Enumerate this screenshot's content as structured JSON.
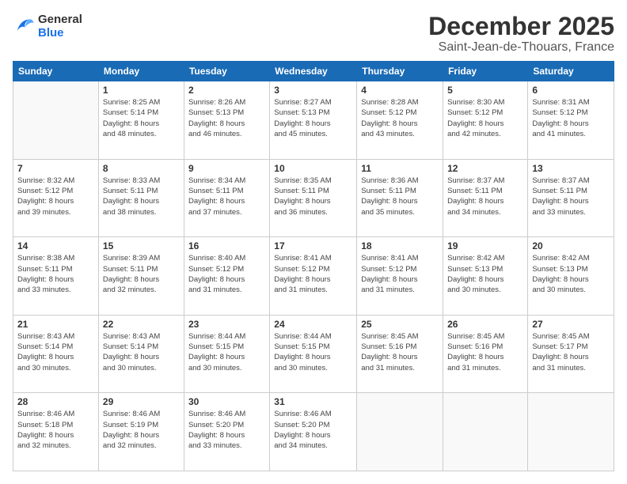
{
  "logo": {
    "line1": "General",
    "line2": "Blue"
  },
  "title": "December 2025",
  "subtitle": "Saint-Jean-de-Thouars, France",
  "weekdays": [
    "Sunday",
    "Monday",
    "Tuesday",
    "Wednesday",
    "Thursday",
    "Friday",
    "Saturday"
  ],
  "weeks": [
    [
      {
        "day": "",
        "info": ""
      },
      {
        "day": "1",
        "info": "Sunrise: 8:25 AM\nSunset: 5:14 PM\nDaylight: 8 hours\nand 48 minutes."
      },
      {
        "day": "2",
        "info": "Sunrise: 8:26 AM\nSunset: 5:13 PM\nDaylight: 8 hours\nand 46 minutes."
      },
      {
        "day": "3",
        "info": "Sunrise: 8:27 AM\nSunset: 5:13 PM\nDaylight: 8 hours\nand 45 minutes."
      },
      {
        "day": "4",
        "info": "Sunrise: 8:28 AM\nSunset: 5:12 PM\nDaylight: 8 hours\nand 43 minutes."
      },
      {
        "day": "5",
        "info": "Sunrise: 8:30 AM\nSunset: 5:12 PM\nDaylight: 8 hours\nand 42 minutes."
      },
      {
        "day": "6",
        "info": "Sunrise: 8:31 AM\nSunset: 5:12 PM\nDaylight: 8 hours\nand 41 minutes."
      }
    ],
    [
      {
        "day": "7",
        "info": "Sunrise: 8:32 AM\nSunset: 5:12 PM\nDaylight: 8 hours\nand 39 minutes."
      },
      {
        "day": "8",
        "info": "Sunrise: 8:33 AM\nSunset: 5:11 PM\nDaylight: 8 hours\nand 38 minutes."
      },
      {
        "day": "9",
        "info": "Sunrise: 8:34 AM\nSunset: 5:11 PM\nDaylight: 8 hours\nand 37 minutes."
      },
      {
        "day": "10",
        "info": "Sunrise: 8:35 AM\nSunset: 5:11 PM\nDaylight: 8 hours\nand 36 minutes."
      },
      {
        "day": "11",
        "info": "Sunrise: 8:36 AM\nSunset: 5:11 PM\nDaylight: 8 hours\nand 35 minutes."
      },
      {
        "day": "12",
        "info": "Sunrise: 8:37 AM\nSunset: 5:11 PM\nDaylight: 8 hours\nand 34 minutes."
      },
      {
        "day": "13",
        "info": "Sunrise: 8:37 AM\nSunset: 5:11 PM\nDaylight: 8 hours\nand 33 minutes."
      }
    ],
    [
      {
        "day": "14",
        "info": "Sunrise: 8:38 AM\nSunset: 5:11 PM\nDaylight: 8 hours\nand 33 minutes."
      },
      {
        "day": "15",
        "info": "Sunrise: 8:39 AM\nSunset: 5:11 PM\nDaylight: 8 hours\nand 32 minutes."
      },
      {
        "day": "16",
        "info": "Sunrise: 8:40 AM\nSunset: 5:12 PM\nDaylight: 8 hours\nand 31 minutes."
      },
      {
        "day": "17",
        "info": "Sunrise: 8:41 AM\nSunset: 5:12 PM\nDaylight: 8 hours\nand 31 minutes."
      },
      {
        "day": "18",
        "info": "Sunrise: 8:41 AM\nSunset: 5:12 PM\nDaylight: 8 hours\nand 31 minutes."
      },
      {
        "day": "19",
        "info": "Sunrise: 8:42 AM\nSunset: 5:13 PM\nDaylight: 8 hours\nand 30 minutes."
      },
      {
        "day": "20",
        "info": "Sunrise: 8:42 AM\nSunset: 5:13 PM\nDaylight: 8 hours\nand 30 minutes."
      }
    ],
    [
      {
        "day": "21",
        "info": "Sunrise: 8:43 AM\nSunset: 5:14 PM\nDaylight: 8 hours\nand 30 minutes."
      },
      {
        "day": "22",
        "info": "Sunrise: 8:43 AM\nSunset: 5:14 PM\nDaylight: 8 hours\nand 30 minutes."
      },
      {
        "day": "23",
        "info": "Sunrise: 8:44 AM\nSunset: 5:15 PM\nDaylight: 8 hours\nand 30 minutes."
      },
      {
        "day": "24",
        "info": "Sunrise: 8:44 AM\nSunset: 5:15 PM\nDaylight: 8 hours\nand 30 minutes."
      },
      {
        "day": "25",
        "info": "Sunrise: 8:45 AM\nSunset: 5:16 PM\nDaylight: 8 hours\nand 31 minutes."
      },
      {
        "day": "26",
        "info": "Sunrise: 8:45 AM\nSunset: 5:16 PM\nDaylight: 8 hours\nand 31 minutes."
      },
      {
        "day": "27",
        "info": "Sunrise: 8:45 AM\nSunset: 5:17 PM\nDaylight: 8 hours\nand 31 minutes."
      }
    ],
    [
      {
        "day": "28",
        "info": "Sunrise: 8:46 AM\nSunset: 5:18 PM\nDaylight: 8 hours\nand 32 minutes."
      },
      {
        "day": "29",
        "info": "Sunrise: 8:46 AM\nSunset: 5:19 PM\nDaylight: 8 hours\nand 32 minutes."
      },
      {
        "day": "30",
        "info": "Sunrise: 8:46 AM\nSunset: 5:20 PM\nDaylight: 8 hours\nand 33 minutes."
      },
      {
        "day": "31",
        "info": "Sunrise: 8:46 AM\nSunset: 5:20 PM\nDaylight: 8 hours\nand 34 minutes."
      },
      {
        "day": "",
        "info": ""
      },
      {
        "day": "",
        "info": ""
      },
      {
        "day": "",
        "info": ""
      }
    ]
  ]
}
